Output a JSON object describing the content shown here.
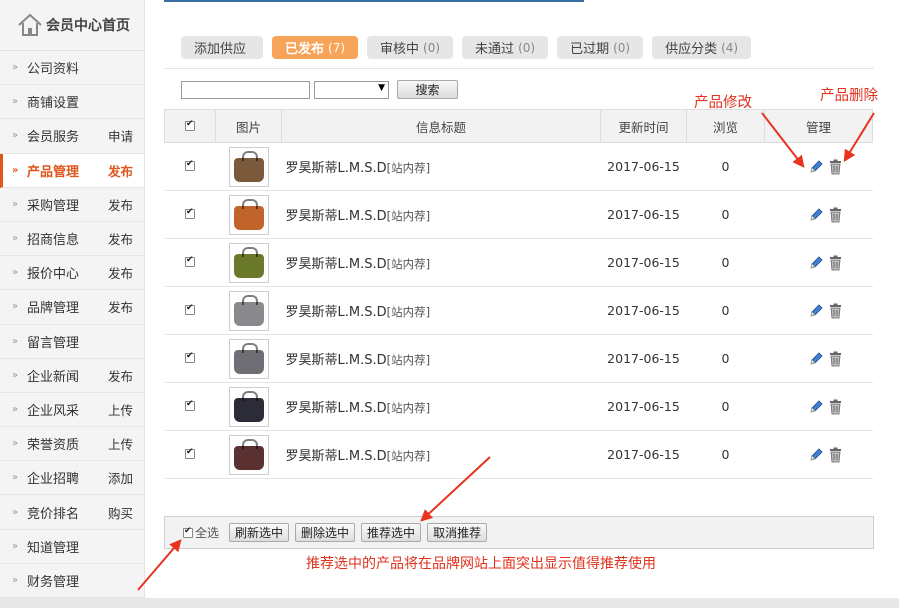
{
  "sidebar": {
    "home_label": "会员中心首页",
    "items": [
      {
        "label": "公司资料",
        "action": ""
      },
      {
        "label": "商铺设置",
        "action": ""
      },
      {
        "label": "会员服务",
        "action": "申请"
      },
      {
        "label": "产品管理",
        "action": "发布",
        "active": true
      },
      {
        "label": "采购管理",
        "action": "发布"
      },
      {
        "label": "招商信息",
        "action": "发布"
      },
      {
        "label": "报价中心",
        "action": "发布"
      },
      {
        "label": "品牌管理",
        "action": "发布"
      },
      {
        "label": "留言管理",
        "action": ""
      },
      {
        "label": "企业新闻",
        "action": "发布"
      },
      {
        "label": "企业风采",
        "action": "上传"
      },
      {
        "label": "荣誉资质",
        "action": "上传"
      },
      {
        "label": "企业招聘",
        "action": "添加"
      },
      {
        "label": "竞价排名",
        "action": "购买"
      },
      {
        "label": "知道管理",
        "action": ""
      },
      {
        "label": "财务管理",
        "action": ""
      }
    ]
  },
  "tabs": [
    {
      "label": "添加供应",
      "count": ""
    },
    {
      "label": "已发布",
      "count": "(7)",
      "active": true
    },
    {
      "label": "审核中",
      "count": "(0)"
    },
    {
      "label": "未通过",
      "count": "(0)"
    },
    {
      "label": "已过期",
      "count": "(0)"
    },
    {
      "label": "供应分类",
      "count": "(4)"
    }
  ],
  "search": {
    "input_value": "",
    "select_value": "",
    "button_label": "搜索"
  },
  "table": {
    "headers": {
      "image": "图片",
      "title": "信息标题",
      "updated": "更新时间",
      "views": "浏览",
      "manage": "管理"
    },
    "rows": [
      {
        "title": "罗昊斯蒂L.M.S.D",
        "tag": "[站内荐]",
        "date": "2017-06-15",
        "views": "0",
        "bag_color": "#7a5a3a"
      },
      {
        "title": "罗昊斯蒂L.M.S.D",
        "tag": "[站内荐]",
        "date": "2017-06-15",
        "views": "0",
        "bag_color": "#c0642c"
      },
      {
        "title": "罗昊斯蒂L.M.S.D",
        "tag": "[站内荐]",
        "date": "2017-06-15",
        "views": "0",
        "bag_color": "#6b7a2a"
      },
      {
        "title": "罗昊斯蒂L.M.S.D",
        "tag": "[站内荐]",
        "date": "2017-06-15",
        "views": "0",
        "bag_color": "#8a8a8e"
      },
      {
        "title": "罗昊斯蒂L.M.S.D",
        "tag": "[站内荐]",
        "date": "2017-06-15",
        "views": "0",
        "bag_color": "#6e6e74"
      },
      {
        "title": "罗昊斯蒂L.M.S.D",
        "tag": "[站内荐]",
        "date": "2017-06-15",
        "views": "0",
        "bag_color": "#2c2c38"
      },
      {
        "title": "罗昊斯蒂L.M.S.D",
        "tag": "[站内荐]",
        "date": "2017-06-15",
        "views": "0",
        "bag_color": "#5a3030"
      }
    ]
  },
  "footer": {
    "select_all": "全选",
    "refresh": "刷新选中",
    "delete": "删除选中",
    "recommend": "推荐选中",
    "cancel_recommend": "取消推荐"
  },
  "annotations": {
    "edit_label": "产品修改",
    "delete_label": "产品删除",
    "note": "推荐选中的产品将在品牌网站上面突出显示值得推荐使用"
  },
  "colors": {
    "accent": "#e0561c",
    "annotation": "#e0321c",
    "tab_active": "#f7a458"
  }
}
